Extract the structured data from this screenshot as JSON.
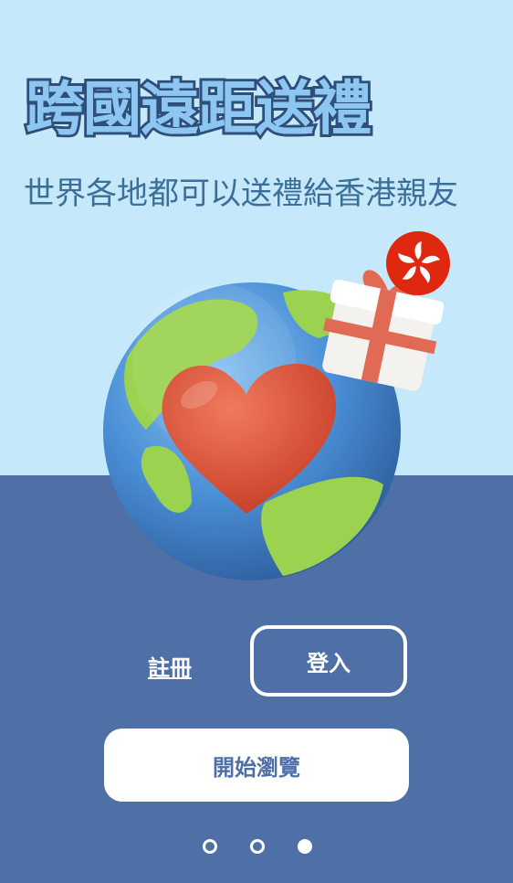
{
  "hero": {
    "headline": "跨國遠距送禮",
    "subtitle": "世界各地都可以送禮給香港親友"
  },
  "auth": {
    "register_label": "註冊",
    "login_label": "登入"
  },
  "browse": {
    "label": "開始瀏覽"
  },
  "pagination": {
    "total": 3,
    "active_index": 2
  },
  "colors": {
    "sky": "#c6e8fb",
    "navy_band": "#4f6fa7",
    "heart": "#e0553d",
    "ocean": "#4a8fd6",
    "land": "#9bd24f",
    "hk_flag": "#de2910"
  },
  "icons": {
    "illustration": "globe-heart-gift-illustration",
    "flag": "hong-kong-flag-icon"
  }
}
